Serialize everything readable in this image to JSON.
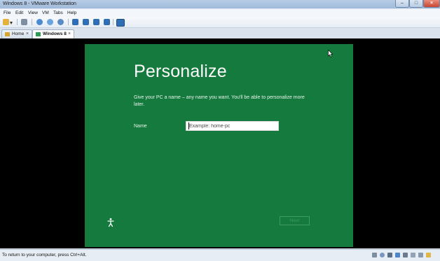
{
  "window": {
    "title": "Windows 8 - VMware Workstation"
  },
  "menu": {
    "items": [
      "File",
      "Edit",
      "View",
      "VM",
      "Tabs",
      "Help"
    ]
  },
  "toolbar": {
    "icons": [
      "power-icon",
      "dropdown-icon",
      "snapshot-manager-icon",
      "take-snapshot-icon",
      "revert-snapshot-icon",
      "manage-snapshots-icon",
      "console-view-icon",
      "quick-switch-icon",
      "fullscreen-icon",
      "unity-icon",
      "view-icon"
    ]
  },
  "tabs": [
    {
      "label": "Home",
      "icon": "home-icon"
    },
    {
      "label": "Windows 8",
      "icon": "vm-icon",
      "active": true
    }
  ],
  "oobe": {
    "heading": "Personalize",
    "description": "Give your PC a name – any name you want. You'll be able to personalize more later.",
    "name_label": "Name",
    "name_placeholder": "Example: home-pc",
    "name_value": "",
    "next_label": "Next",
    "background_color": "#157a3d",
    "ease_of_access_icon": "ease-of-access-icon"
  },
  "statusbar": {
    "message": "To return to your computer, press Ctrl+Alt.",
    "icons": [
      "hdd-icon",
      "cd-icon",
      "floppy-icon",
      "network-icon",
      "usb-icon",
      "sound-icon",
      "printer-icon",
      "message-icon"
    ]
  }
}
